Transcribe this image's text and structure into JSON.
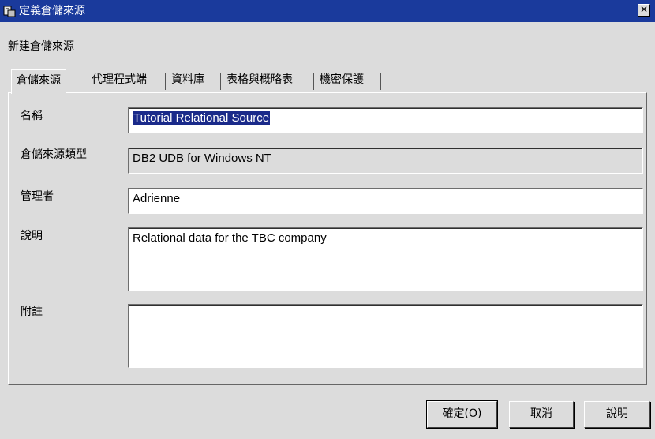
{
  "window": {
    "title": "定義倉儲來源",
    "close_label": "✕"
  },
  "subtitle": "新建倉儲來源",
  "tabs": [
    {
      "label": "倉儲來源",
      "active": true
    },
    {
      "label": "代理程式端",
      "active": false
    },
    {
      "label": "資料庫",
      "active": false
    },
    {
      "label": "表格與概略表",
      "active": false
    },
    {
      "label": "機密保護",
      "active": false
    }
  ],
  "form": {
    "name_label": "名稱",
    "name_value": "Tutorial Relational Source",
    "type_label": "倉儲來源類型",
    "type_value": "DB2 UDB for Windows NT",
    "admin_label": "管理者",
    "admin_value": "Adrienne",
    "desc_label": "說明",
    "desc_value": "Relational data for the TBC company",
    "notes_label": "附註",
    "notes_value": ""
  },
  "buttons": {
    "ok_label": "確定",
    "ok_mnemonic": "(O)",
    "cancel_label": "取消",
    "help_label": "說明"
  }
}
